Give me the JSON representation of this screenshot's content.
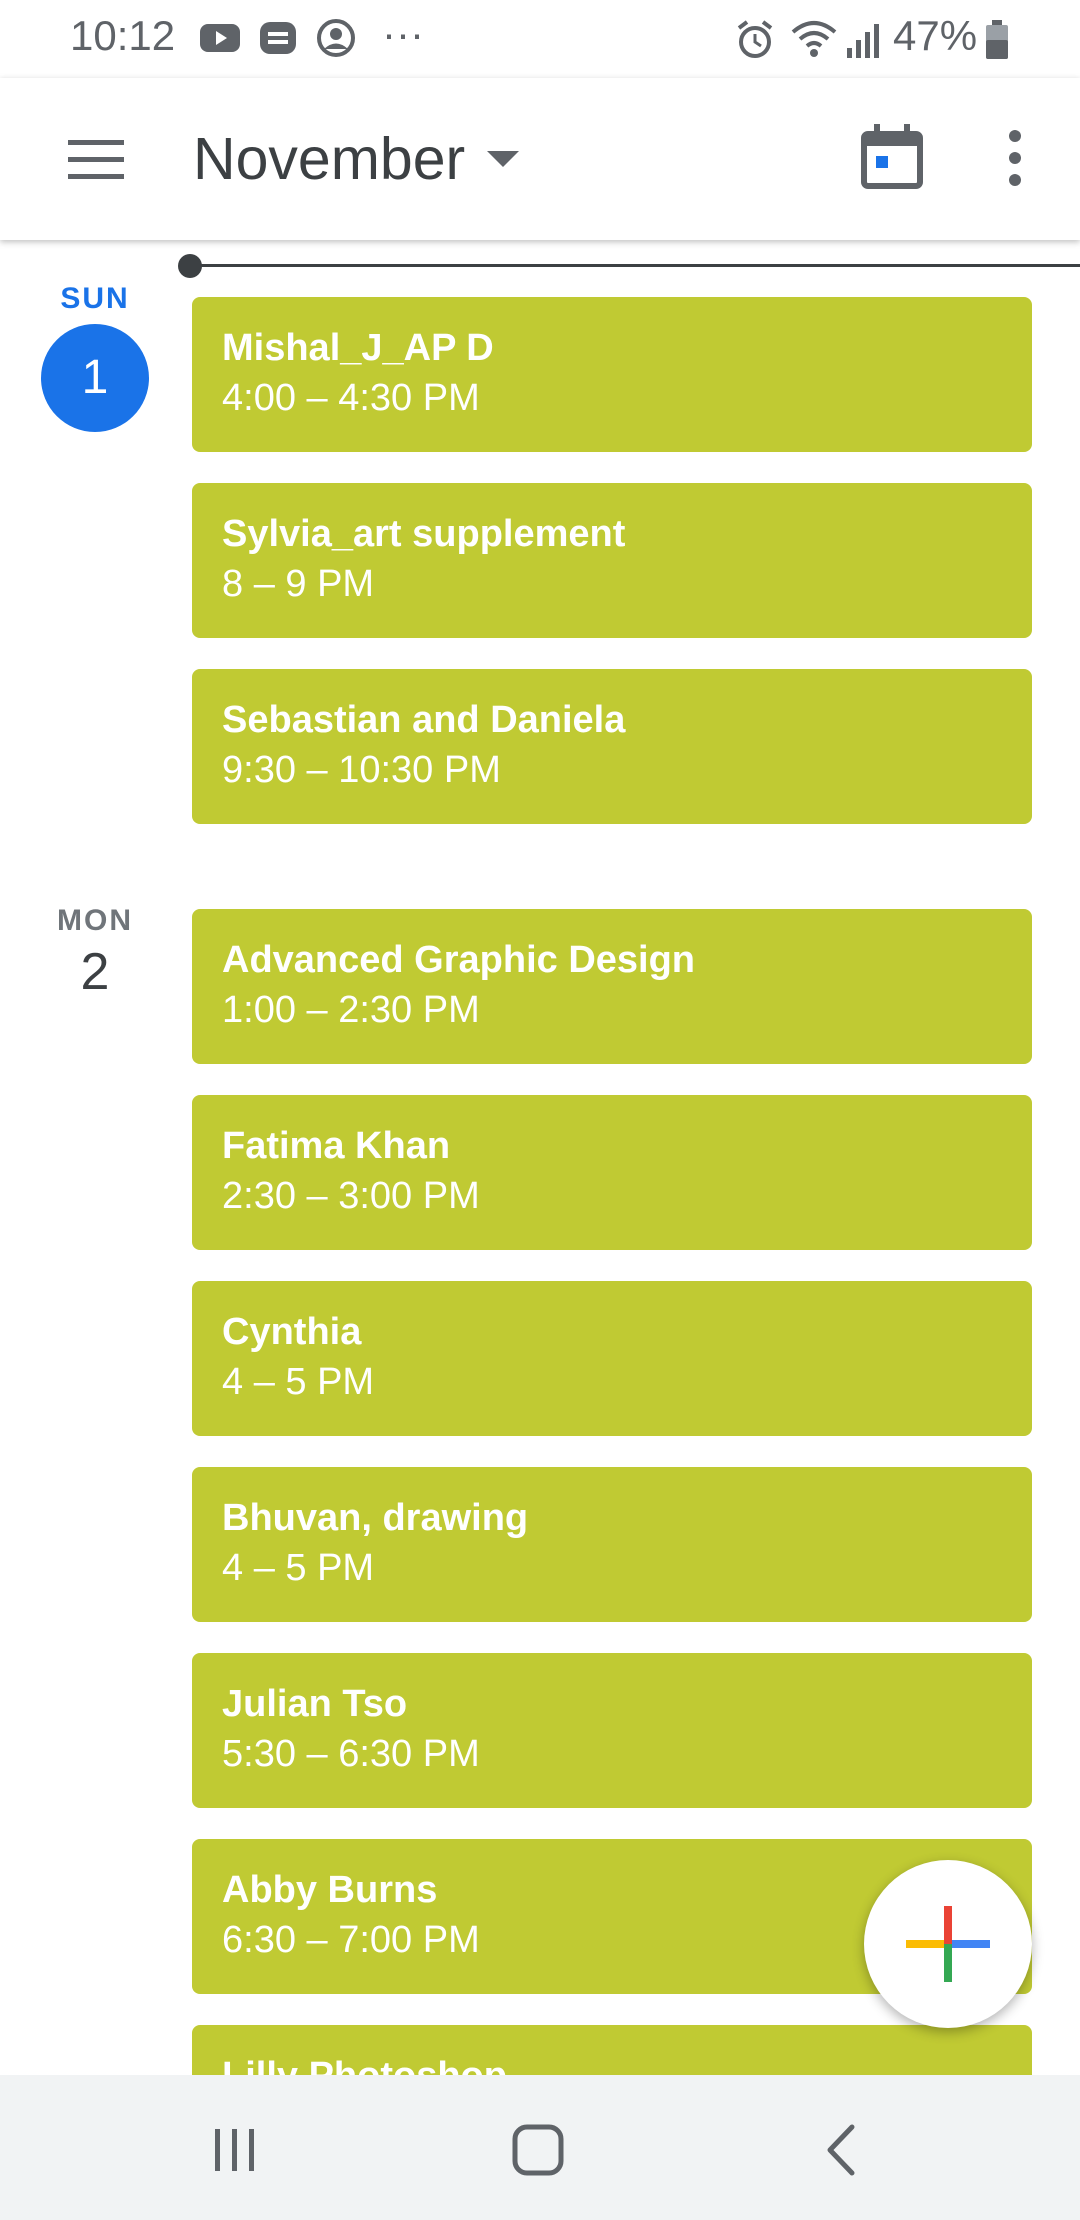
{
  "status_bar": {
    "time": "10:12",
    "overflow_dots": "···",
    "battery_percent": "47%",
    "icons": [
      "youtube-icon",
      "messenger-icon",
      "account-icon",
      "alarm-icon",
      "wifi-icon",
      "signal-icon",
      "battery-icon"
    ]
  },
  "app_bar": {
    "month": "November",
    "icons": [
      "menu-icon",
      "dropdown-caret-icon",
      "today-calendar-icon",
      "more-vert-icon"
    ]
  },
  "days": [
    {
      "dow": "SUN",
      "date": "1",
      "is_today": true
    },
    {
      "dow": "MON",
      "date": "2",
      "is_today": false
    }
  ],
  "events": [
    {
      "title": "Mishal_J_AP D",
      "time": "4:00 – 4:30 PM"
    },
    {
      "title": "Sylvia_art supplement",
      "time": "8 – 9 PM"
    },
    {
      "title": "Sebastian and Daniela",
      "time": "9:30 – 10:30 PM"
    },
    {
      "title": "Advanced Graphic Design",
      "time": "1:00 – 2:30 PM"
    },
    {
      "title": "Fatima Khan",
      "time": "2:30 – 3:00 PM"
    },
    {
      "title": "Cynthia",
      "time": "4 – 5 PM"
    },
    {
      "title": "Bhuvan, drawing",
      "time": "4 – 5 PM"
    },
    {
      "title": "Julian Tso",
      "time": "5:30 – 6:30 PM"
    },
    {
      "title": "Abby Burns",
      "time": "6:30 – 7:00 PM"
    },
    {
      "title": "Lilly Photoshop",
      "time": ""
    }
  ],
  "colors": {
    "event": "#c0ca33",
    "accent": "#1a73e8",
    "fab_plus": [
      "#ea4335",
      "#4285f4",
      "#34a853",
      "#fbbc04"
    ]
  },
  "nav": {
    "icons": [
      "recents-icon",
      "home-icon",
      "back-icon"
    ]
  }
}
